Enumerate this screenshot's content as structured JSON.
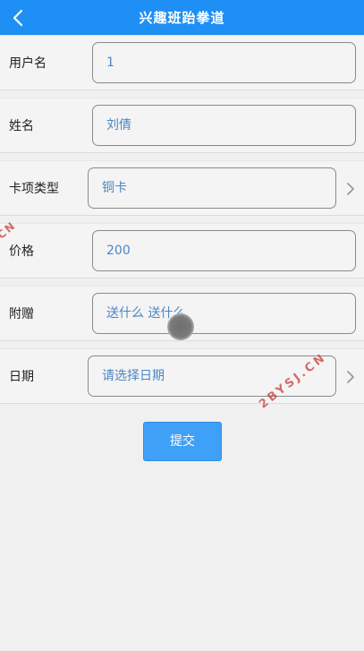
{
  "header": {
    "title": "兴趣班跆拳道"
  },
  "form": {
    "username": {
      "label": "用户名",
      "value": "1"
    },
    "name": {
      "label": "姓名",
      "value": "刘倩"
    },
    "card_type": {
      "label": "卡项类型",
      "value": "铜卡"
    },
    "price": {
      "label": "价格",
      "value": "200"
    },
    "gift": {
      "label": "附赠",
      "value": "送什么 送什么"
    },
    "date": {
      "label": "日期",
      "value": "请选择日期"
    }
  },
  "submit_label": "提交",
  "watermarks": {
    "left": "CN",
    "right": "2BYSJ.CN"
  },
  "colors": {
    "header_bg": "#1e90f5",
    "value_text": "#4a86c5",
    "button_bg": "#3fa0f7",
    "watermark": "#c83c3c"
  },
  "icons": {
    "back": "chevron-left-icon",
    "select_arrow": "chevron-right-icon"
  }
}
